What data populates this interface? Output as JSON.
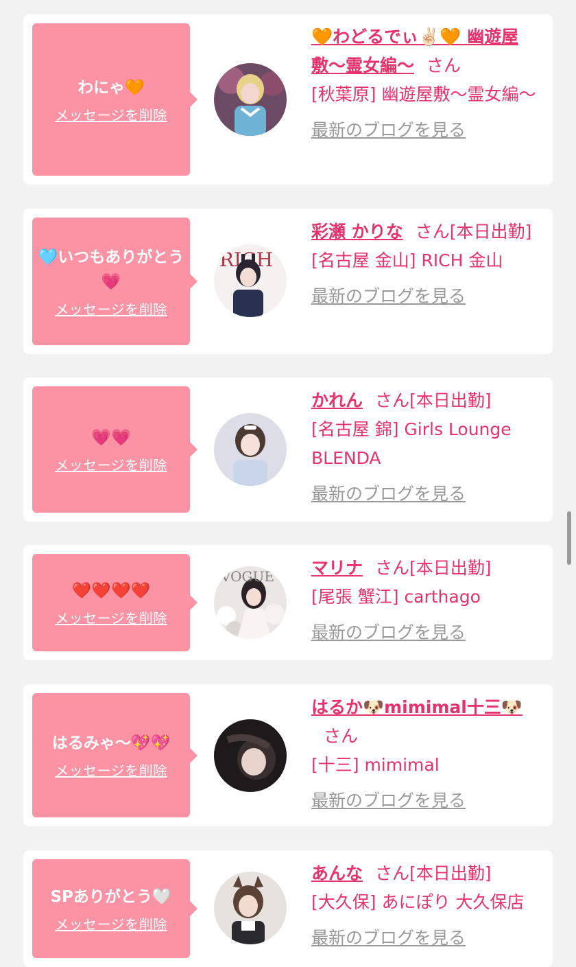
{
  "cards": [
    {
      "message": "わにゃ🧡",
      "delete_label": "メッセージを削除",
      "name": "🧡わどるでぃ✌🏻🧡 幽遊屋敷〜霊女編〜",
      "san": "さん",
      "status": "",
      "shop": "[秋葉原] 幽遊屋敷〜霊女編〜",
      "blog_label": "最新のブログを見る"
    },
    {
      "message": "🩵いつもありがとう💗",
      "delete_label": "メッセージを削除",
      "name": "彩瀬 かりな",
      "san": "さん",
      "status": "[本日出勤]",
      "shop": "[名古屋 金山] RICH 金山",
      "blog_label": "最新のブログを見る"
    },
    {
      "message": "💗💗",
      "delete_label": "メッセージを削除",
      "name": "かれん",
      "san": "さん",
      "status": "[本日出勤]",
      "shop": "[名古屋 錦] Girls Lounge BLENDA",
      "blog_label": "最新のブログを見る"
    },
    {
      "message": "❤️❤️❤️❤️",
      "delete_label": "メッセージを削除",
      "name": "マリナ",
      "san": "さん",
      "status": "[本日出勤]",
      "shop": "[尾張 蟹江] carthago",
      "blog_label": "最新のブログを見る"
    },
    {
      "message": "はるみゃ〜💖💖",
      "delete_label": "メッセージを削除",
      "name": "はるか🐶mimimal十三🐶",
      "san": "さん",
      "status": "",
      "shop": "[十三] mimimal",
      "blog_label": "最新のブログを見る"
    },
    {
      "message": "SPありがとう🤍",
      "delete_label": "メッセージを削除",
      "name": "あんな",
      "san": "さん",
      "status": "[本日出勤]",
      "shop": "[大久保] あにぽり 大久保店",
      "blog_label": "最新のブログを見る"
    }
  ]
}
